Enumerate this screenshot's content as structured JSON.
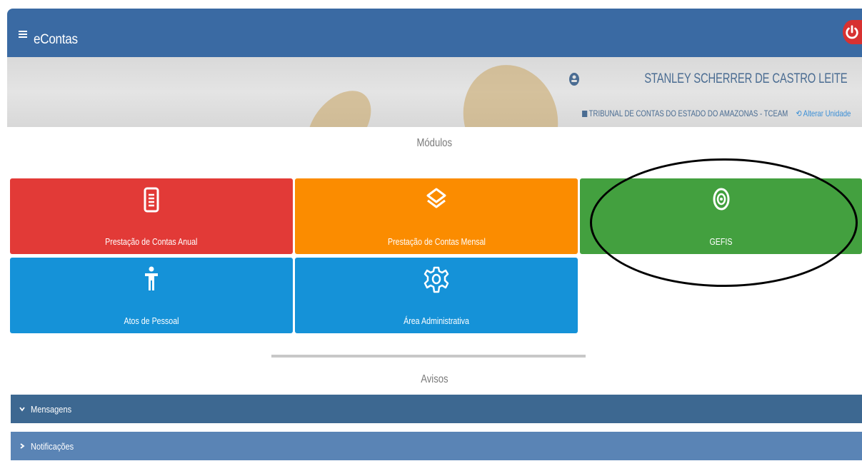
{
  "header": {
    "app_title": "eContas",
    "menu_icon": "hamburger-icon",
    "power_icon": "power-icon",
    "color": "#3a6aa3"
  },
  "user": {
    "name": "STANLEY SCHERRER DE CASTRO LEITE",
    "organization": "TRIBUNAL DE CONTAS DO ESTADO DO AMAZONAS - TCEAM",
    "change_unit_label": "Alterar Unidade"
  },
  "modules": {
    "title": "Módulos",
    "items": [
      {
        "label": "Prestação de Contas Anual",
        "icon": "document-icon",
        "color": "#e23a37"
      },
      {
        "label": "Prestação de Contas Mensal",
        "icon": "layers-icon",
        "color": "#fb8c00"
      },
      {
        "label": "GEFIS",
        "icon": "target-icon",
        "color": "#43a03f"
      },
      {
        "label": "Atos de Pessoal",
        "icon": "person-icon",
        "color": "#1592d8"
      },
      {
        "label": "Área Administrativa",
        "icon": "gear-icon",
        "color": "#1592d8"
      }
    ]
  },
  "notices": {
    "title": "Avisos",
    "messages_label": "Mensagens",
    "notifications_label": "Notificações"
  }
}
